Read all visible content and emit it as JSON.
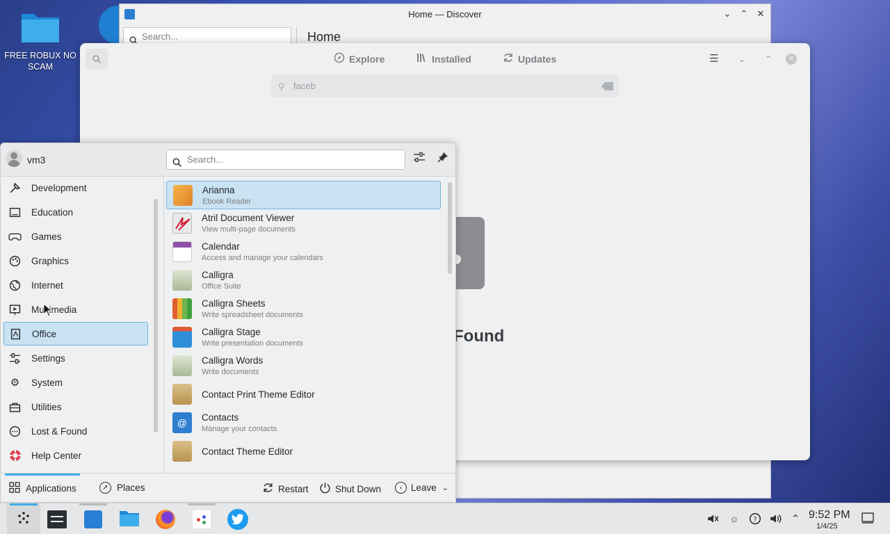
{
  "desktop": {
    "icon_label": "FREE ROBUX NO SCAM"
  },
  "discover_back": {
    "title": "Home — Discover",
    "search_placeholder": "Search...",
    "heading": "Home"
  },
  "discover_front": {
    "tabs": [
      "Explore",
      "Installed",
      "Updates"
    ],
    "search_query": "faceb",
    "not_found_text": "Found"
  },
  "launcher": {
    "username": "vm3",
    "search_placeholder": "Search...",
    "categories": [
      {
        "label": "Development",
        "icon": "development-icon"
      },
      {
        "label": "Education",
        "icon": "education-icon"
      },
      {
        "label": "Games",
        "icon": "games-icon"
      },
      {
        "label": "Graphics",
        "icon": "graphics-icon"
      },
      {
        "label": "Internet",
        "icon": "internet-icon"
      },
      {
        "label": "Multimedia",
        "icon": "multimedia-icon"
      },
      {
        "label": "Office",
        "icon": "office-icon",
        "selected": true
      },
      {
        "label": "Settings",
        "icon": "settings-icon"
      },
      {
        "label": "System",
        "icon": "system-icon"
      },
      {
        "label": "Utilities",
        "icon": "utilities-icon"
      },
      {
        "label": "Lost & Found",
        "icon": "lost-found-icon"
      },
      {
        "label": "Help Center",
        "icon": "help-center-icon"
      }
    ],
    "apps": [
      {
        "name": "Arianna",
        "desc": "Ebook Reader",
        "icon": "arianna-icon",
        "color": "#f0a030",
        "selected": true
      },
      {
        "name": "Atril Document Viewer",
        "desc": "View multi-page documents",
        "icon": "atril-icon",
        "color": "#d8dadc"
      },
      {
        "name": "Calendar",
        "desc": "Access and manage your calendars",
        "icon": "calendar-icon",
        "color": "#8e4fa8"
      },
      {
        "name": "Calligra",
        "desc": "Office Suite",
        "icon": "calligra-icon",
        "color": "#b8c4a8"
      },
      {
        "name": "Calligra Sheets",
        "desc": "Write spreadsheet documents",
        "icon": "calligra-sheets-icon",
        "color": "#6fb84f"
      },
      {
        "name": "Calligra Stage",
        "desc": "Write presentation documents",
        "icon": "calligra-stage-icon",
        "color": "#2f8fd8"
      },
      {
        "name": "Calligra Words",
        "desc": "Write documents",
        "icon": "calligra-words-icon",
        "color": "#b8c4a8"
      },
      {
        "name": "Contact Print Theme Editor",
        "desc": "",
        "icon": "contact-print-theme-icon",
        "color": "#c9a86a"
      },
      {
        "name": "Contacts",
        "desc": "Manage your contacts",
        "icon": "contacts-icon",
        "color": "#2f7fd0"
      },
      {
        "name": "Contact Theme Editor",
        "desc": "",
        "icon": "contact-theme-icon",
        "color": "#c9a86a"
      }
    ],
    "footer": {
      "applications": "Applications",
      "places": "Places",
      "restart": "Restart",
      "shutdown": "Shut Down",
      "leave": "Leave"
    }
  },
  "taskbar": {
    "time": "9:52 PM",
    "date": "1/4/25"
  }
}
